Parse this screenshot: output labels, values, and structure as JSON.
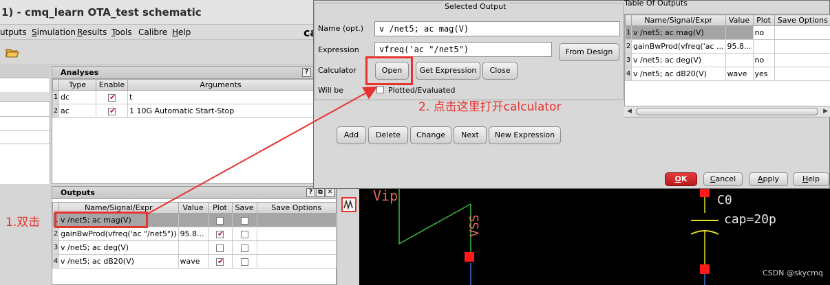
{
  "window": {
    "title": "1) - cmq_learn OTA_test schematic",
    "menus": [
      {
        "text": "utputs",
        "ul": ""
      },
      {
        "text": "imulation",
        "ul": "S"
      },
      {
        "text": "esults",
        "ul": "R"
      },
      {
        "text": "ools",
        "ul": "T"
      },
      {
        "text": "Calibre",
        "ul": ""
      },
      {
        "text": "elp",
        "ul": "H"
      }
    ],
    "brand_fragment": "ca"
  },
  "analyses": {
    "title": "Analyses",
    "help_glyph": "?",
    "columns": [
      "Type",
      "Enable",
      "Arguments"
    ],
    "rows": [
      {
        "n": "1",
        "type": "dc",
        "enabled": true,
        "args": "t"
      },
      {
        "n": "2",
        "type": "ac",
        "enabled": true,
        "args": "1 10G Automatic Start-Stop"
      }
    ]
  },
  "outputs": {
    "title": "Outputs",
    "columns": [
      "Name/Signal/Expr",
      "Value",
      "Plot",
      "Save",
      "Save Options"
    ],
    "rows": [
      {
        "n": "1",
        "name": "v /net5; ac mag(V)",
        "value": "",
        "plot": false,
        "save": false,
        "selected": true
      },
      {
        "n": "2",
        "name": "gainBwProd(vfreq('ac \"/net5\"))",
        "value": "95.8...",
        "plot": true,
        "save": false,
        "selected": false
      },
      {
        "n": "3",
        "name": "v /net5; ac deg(V)",
        "value": "",
        "plot": false,
        "save": false,
        "selected": false
      },
      {
        "n": "4",
        "name": "v /net5; ac dB20(V)",
        "value": "wave",
        "plot": true,
        "save": false,
        "selected": false
      }
    ]
  },
  "dialog": {
    "selected_output_legend": "Selected Output",
    "name_label": "Name (opt.)",
    "name_value": "v /net5; ac mag(V)",
    "expression_label": "Expression",
    "expression_value": "vfreq('ac \"/net5\")",
    "from_design_button": "From Design",
    "calculator_label": "Calculator",
    "open_button": "Open",
    "get_expression_button": "Get Expression",
    "close_button": "Close",
    "will_be_label": "Will be",
    "plotted_evaluated_label": "Plotted/Evaluated",
    "plotted_evaluated_checked": false,
    "buttons": [
      "Add",
      "Delete",
      "Change",
      "Next",
      "New Expression"
    ],
    "ok_button": {
      "ul": "O",
      "rest": "K"
    },
    "cancel_button": {
      "ul": "C",
      "rest": "ancel"
    },
    "apply_button": {
      "ul": "A",
      "rest": "pply"
    },
    "help_button": {
      "ul": "H",
      "rest": "elp"
    },
    "table_title": "Table Of Outputs",
    "table_columns": [
      "Name/Signal/Expr",
      "Value",
      "Plot",
      "Save Options"
    ],
    "table_rows": [
      {
        "n": "1",
        "name": "v /net5; ac mag(V)",
        "value": "",
        "plot": "no",
        "selected": true
      },
      {
        "n": "2",
        "name": "gainBwProd(vfreq('ac ...",
        "value": "95.8...",
        "plot": "",
        "selected": false
      },
      {
        "n": "3",
        "name": "v /net5; ac deg(V)",
        "value": "",
        "plot": "no",
        "selected": false
      },
      {
        "n": "4",
        "name": "v /net5; ac dB20(V)",
        "value": "wave",
        "plot": "yes",
        "selected": false
      }
    ]
  },
  "schematic": {
    "labels": {
      "vip": "Vip",
      "vss": "VSS",
      "c0": "C0",
      "cap": "cap=20p"
    },
    "colors": {
      "wire": "#3bbf3b",
      "label": "#e06a5a",
      "pin": "#ff1a1a",
      "cap": "#e0e020",
      "label2": "#e6e6e6"
    }
  },
  "annotations": {
    "step1": "1.双击",
    "step2": "2. 点击这里打开calculator",
    "color": "#e8322e"
  },
  "watermark": "CSDN @skycmq"
}
